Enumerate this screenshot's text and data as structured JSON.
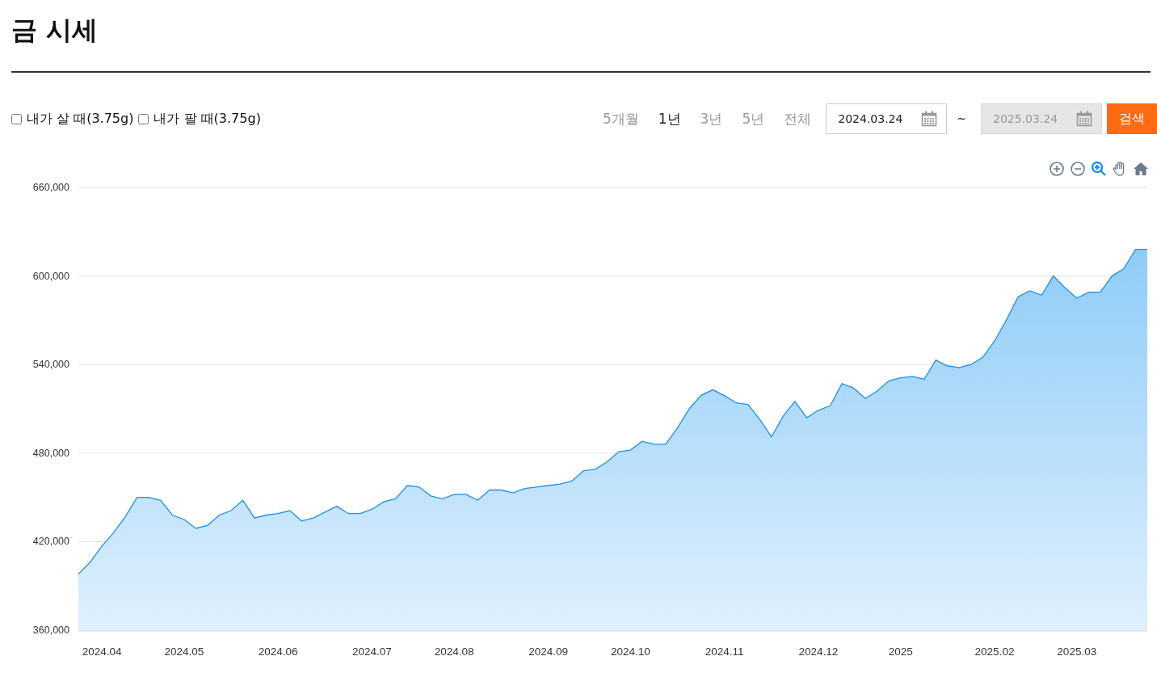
{
  "title": "금 시세",
  "filters": [
    {
      "label": "내가 살 때(3.75g)",
      "checked": false
    },
    {
      "label": "내가 팔 때(3.75g)",
      "checked": false
    }
  ],
  "periods": [
    {
      "label": "5개월",
      "selected": false
    },
    {
      "label": "1년",
      "selected": true
    },
    {
      "label": "3년",
      "selected": false
    },
    {
      "label": "5년",
      "selected": false
    },
    {
      "label": "전체",
      "selected": false
    }
  ],
  "date_from": {
    "value": "2024.03.24",
    "disabled": false
  },
  "range_separator": "~",
  "date_to": {
    "value": "2025.03.24",
    "disabled": true
  },
  "search_button": "검색",
  "chart_toolbar": [
    {
      "kind": "zoom-in",
      "selected": false
    },
    {
      "kind": "zoom-out",
      "selected": false
    },
    {
      "kind": "zoom",
      "selected": true
    },
    {
      "kind": "pan",
      "selected": false
    },
    {
      "kind": "home",
      "selected": false
    }
  ],
  "chart": {
    "chart_data": {
      "type": "area",
      "categories": [
        null,
        null,
        "2024.04",
        null,
        null,
        null,
        null,
        null,
        null,
        "2024.05",
        null,
        null,
        null,
        null,
        null,
        null,
        null,
        "2024.06",
        null,
        null,
        null,
        null,
        null,
        null,
        null,
        "2024.07",
        null,
        null,
        null,
        null,
        null,
        null,
        "2024.08",
        null,
        null,
        null,
        null,
        null,
        null,
        null,
        "2024.09",
        null,
        null,
        null,
        null,
        null,
        null,
        "2024.10",
        null,
        null,
        null,
        null,
        null,
        null,
        null,
        "2024.11",
        null,
        null,
        null,
        null,
        null,
        null,
        null,
        "2024.12",
        null,
        null,
        null,
        null,
        null,
        null,
        "2025",
        null,
        null,
        null,
        null,
        null,
        null,
        null,
        "2025.02",
        null,
        null,
        null,
        null,
        null,
        null,
        "2025.03",
        null,
        null,
        null,
        null,
        null,
        null
      ],
      "series": [
        {
          "color": "#1e90ee",
          "values": [
            398000,
            406000,
            417000,
            426000,
            437000,
            450000,
            450000,
            448000,
            438000,
            435000,
            429000,
            431000,
            438000,
            441000,
            448000,
            436000,
            438000,
            439000,
            441000,
            434000,
            436000,
            440000,
            444000,
            439000,
            439000,
            442000,
            447000,
            449000,
            458000,
            457000,
            451000,
            449000,
            452000,
            452000,
            448000,
            455000,
            455000,
            453000,
            456000,
            457000,
            458000,
            459000,
            461000,
            468000,
            469000,
            474000,
            481000,
            482000,
            488000,
            486000,
            486000,
            497000,
            510000,
            519000,
            523000,
            519000,
            514000,
            513000,
            503000,
            491000,
            505000,
            515000,
            504000,
            509000,
            512000,
            527000,
            524000,
            517000,
            522000,
            529000,
            531000,
            532000,
            530000,
            543000,
            539000,
            538000,
            540000,
            545000,
            556000,
            570000,
            586000,
            590000,
            587000,
            600000,
            592000,
            585000,
            589000,
            589000,
            600000,
            605000,
            618000,
            618000
          ]
        }
      ],
      "ylim": [
        360000,
        660000
      ],
      "grid": true,
      "yticks": [
        {
          "value": 360000,
          "label": "360,000"
        },
        {
          "value": 420000,
          "label": "420,000"
        },
        {
          "value": 480000,
          "label": "480,000"
        },
        {
          "value": 540000,
          "label": "540,000"
        },
        {
          "value": 600000,
          "label": "600,000"
        },
        {
          "value": 660000,
          "label": "660,000"
        }
      ]
    }
  }
}
